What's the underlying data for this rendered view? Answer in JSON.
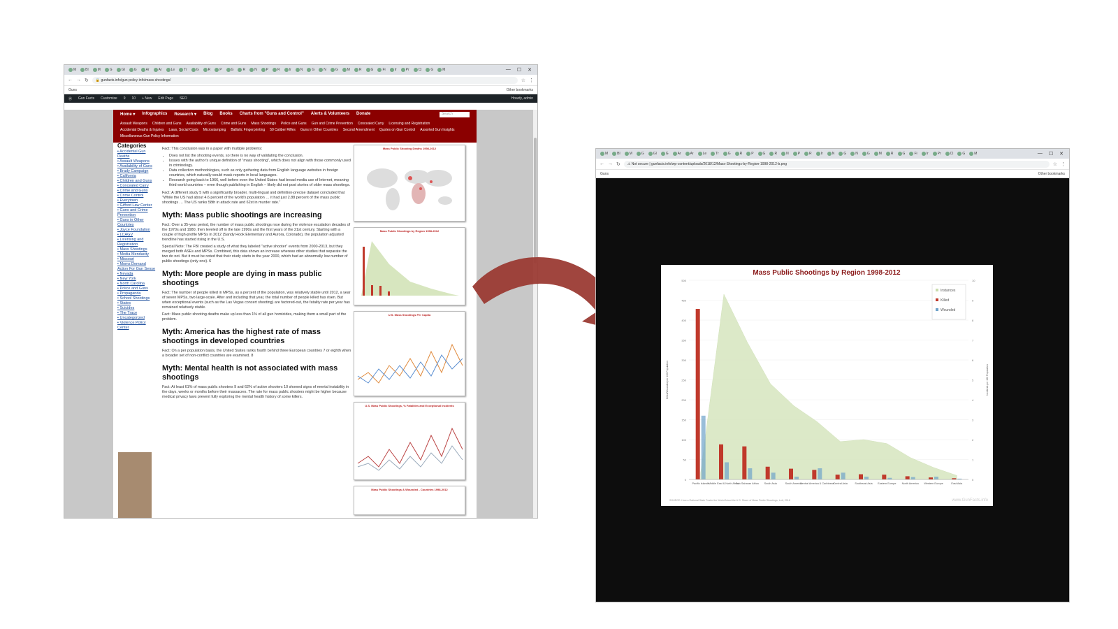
{
  "browser1": {
    "tabs": [
      "M",
      "Bl",
      "M",
      "G",
      "Gl",
      "G",
      "Ar",
      "Ar",
      "Le",
      "Tr",
      "G",
      "R",
      "P",
      "G",
      "R",
      "N",
      "P",
      "R",
      "Ir",
      "N",
      "G",
      "N",
      "G",
      "M",
      "R",
      "G",
      "Fi",
      "Ir",
      "Pr",
      "Cl",
      "G",
      "M"
    ],
    "url": "gunfacts.info/gun-policy-info/mass-shootings/",
    "bookmark": "Guns",
    "other_bookmarks": "Other bookmarks",
    "admin_bar": {
      "site": "Gun Facts",
      "customize": "Customize",
      "updates": "9",
      "comments": "10",
      "new": "+ New",
      "edit": "Edit Page",
      "seo": "SEO",
      "user": "Howdy, admin"
    }
  },
  "site": {
    "main_nav": [
      "Home ▾",
      "Infographics",
      "Research ▾",
      "Blog",
      "Books",
      "Charts from \"Guns and Control\"",
      "Alerts & Volunteers",
      "Donate"
    ],
    "search_placeholder": "Search",
    "sub_nav": [
      "Assault Weapons",
      "Children and Guns",
      "Availability of Guns",
      "Crime and Guns",
      "Mass Shootings",
      "Police and Guns",
      "Gun and Crime Prevention",
      "Concealed Carry",
      "Licensing and Registration",
      "Accidental Deaths & Injuries",
      "Laws, Social Costs",
      "Microstamping",
      "Ballistic Fingerprinting",
      "50 Caliber Rifles",
      "Guns in Other Countries",
      "Second Amendment",
      "Quotes on Gun Control",
      "Assorted Gun Insights",
      "Miscellaneous Gun Policy Information"
    ],
    "categories_title": "Categories",
    "categories": [
      "Accidental Gun Deaths",
      "Assault Weapons",
      "Availability of Guns",
      "Brady Campaign",
      "California",
      "Children and Guns",
      "Concealed Carry",
      "Crime and Guns",
      "Crime Control",
      "Everytown",
      "Gifford Law Center",
      "Guns and Crime Prevention",
      "Guns in Other Countries",
      "Joyce Foundation",
      "LCAGV",
      "Licensing and Registration",
      "Mass Shootings",
      "Media Mendacity",
      "Missouri",
      "Moms Demand Action For Gun Sense",
      "Nevada",
      "New York",
      "North Carolina",
      "Police and Guns",
      "Propaganda",
      "School Shootings",
      "States",
      "Suicides",
      "The Trace",
      "Uncategorized",
      "Violence Policy Center"
    ]
  },
  "article": {
    "intro": "Fact: This conclusion was in a paper with multiple problems:",
    "bullets": [
      "Does not list the shooting events, so there is no way of validating the conclusion.",
      "Issues with the author's unique definition of \"mass shooting\", which does not align with those commonly used in criminology.",
      "Data collection methodologies, such as only gathering data from English language websites in foreign countries, which naturally would mask reports in local languages.",
      "Research going back to 1966, well before even the United States had broad media use of Internet, meaning third world countries – even though publishing in English – likely did not post stories of older mass shootings."
    ],
    "p1": "Fact: A different study 5 with a significantly broader, multi-lingual and definition-precise dataset concluded that \"While the US had about 4.6 percent of the world's population … it had just 2.88 percent of the mass public shootings … The US ranks 58th in attack rate and 62st in murder rate.\"",
    "h1": "Myth: Mass public shootings are increasing",
    "p2": "Fact: Over a 35-year period, the number of mass public shootings rose during the violence escalation decades of the 1970s and 1980, then leveled off in the late 1990s and the first years of the 21st century. Starting with a couple of high-profile MPSs in 2012 (Sandy Hook Elementary and Aurora, Colorado), the population adjusted trendline has started rising in the U.S.",
    "p3": "Special Note: The FBI created a study of what they labeled \"active shooter\" events from 2000-2013, but they merged both ASEs and MPSs. Combined, this data shows an increase whereas other studies that separate the two do not. But it must be noted that their study starts in the year 2000, which had an abnormally low number of public shootings (only one). 6",
    "h2": "Myth: More people are dying in mass public shootings",
    "p4": "Fact: The number of people killed in MPSs, as a percent of the population, was relatively stable until 2012, a year of seven MPSs, two large-scale. After and including that year, the total number of people killed has risen. But when exceptional events (such as the Las Vegas concert shooting) are factored-out, the fatality rate per year has remained relatively stable.",
    "p5": "Fact: Mass public shooting deaths make up less than 1% of all gun homicides, making them a small part of the problem.",
    "h3": "Myth: America has the highest rate of mass shootings in developed countries",
    "p6": "Fact: On a per population basis, the United States ranks fourth behind three European countries 7 or eighth when a broader set of non-conflict countries are examined. 8",
    "h4": "Myth: Mental health is not associated with mass shootings",
    "p7": "Fact: At least 61% of mass public shooters 9 and 62% of active shooters 10 showed signs of mental instability in the days, weeks or months before their massacres. The rate for mass public shooters might be higher because medical privacy laws prevent fully exploring the mental health history of some killers."
  },
  "thumbnails": [
    {
      "title": "Mass Public Shooting Deaths 1998-2012"
    },
    {
      "title": "Mass Public Shootings by Region 1998-2012"
    },
    {
      "title": "U.S. Mass Shootings Per Capita"
    },
    {
      "title": "U.S. Mass Public Shootings, % Fatalities and Exceptional Incidents"
    },
    {
      "title": "Mass Public Shootings & Wounded - Countries 1998-2012"
    }
  ],
  "browser2": {
    "url_prefix": "Not secure",
    "url": "gunfacts.info/wp-content/uploads/2018/12/Mass-Shootings-by-Region-1998-2012-b.png",
    "bookmark": "Guns",
    "other_bookmarks": "Other bookmarks"
  },
  "chart_data": {
    "type": "bar",
    "title": "Mass Public Shootings by Region 1998-2012",
    "ylabel": "Killed/Wounded per 100 Population",
    "y2label": "Incidents per 100 Population",
    "ylim": [
      0,
      500
    ],
    "y2lim": [
      0,
      10
    ],
    "yticks": [
      0,
      50,
      100,
      150,
      200,
      250,
      300,
      350,
      400,
      450,
      500
    ],
    "y2ticks": [
      0,
      1,
      2,
      3,
      4,
      5,
      6,
      7,
      8,
      9,
      10
    ],
    "categories": [
      "Pacific Islands",
      "Middle East & North Africa",
      "Sub-Saharan Africa",
      "South Asia",
      "South America",
      "Central America & Caribbean",
      "Central Asia",
      "Southeast Asia",
      "Eastern Europe",
      "North America",
      "Western Europe",
      "East Asia"
    ],
    "series": [
      {
        "name": "Instances",
        "type": "area",
        "axis": "right",
        "values": [
          0.3,
          9.3,
          6.9,
          4.8,
          3.7,
          2.9,
          1.9,
          2.0,
          1.8,
          1.1,
          0.6,
          0.2
        ]
      },
      {
        "name": "Killed",
        "color": "#c0392b",
        "values": [
          428,
          88,
          83,
          32,
          27,
          24,
          12,
          13,
          12,
          8,
          5,
          3
        ]
      },
      {
        "name": "Wounded",
        "color": "#6ea2c9",
        "values": [
          160,
          43,
          28,
          17,
          7,
          28,
          17,
          7,
          4,
          6,
          7,
          2
        ]
      }
    ],
    "legend": "top-right",
    "source": "SOURCE: How a Rational State Foster the World About the U.S. Share of Mass Public Shootings, Lott, 2018",
    "watermark": "www.GunFacts.info"
  },
  "browser2_tabs": [
    "M",
    "Bl",
    "M",
    "G",
    "Gl",
    "G",
    "Ar",
    "Ar",
    "Le",
    "Tr",
    "G",
    "R",
    "P",
    "G",
    "R",
    "N",
    "P",
    "R",
    "Ir",
    "N",
    "G",
    "N",
    "G",
    "M",
    "R",
    "G",
    "Fi",
    "Ir",
    "Pr",
    "Cl",
    "G",
    "M"
  ]
}
